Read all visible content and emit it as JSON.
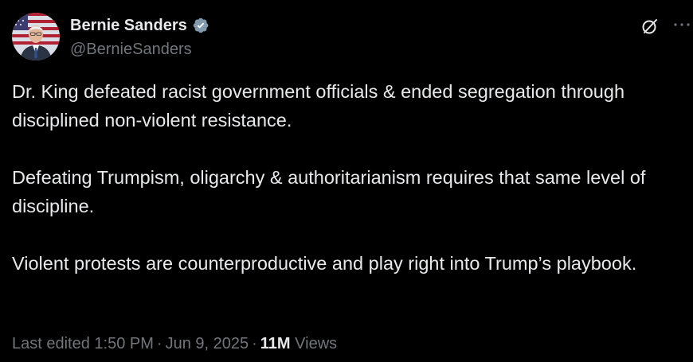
{
  "author": {
    "display_name": "Bernie Sanders",
    "handle": "@BernieSanders",
    "verified": true
  },
  "post": {
    "paragraphs": [
      "Dr. King defeated racist government officials & ended segregation through disciplined non-violent resistance.",
      "Defeating Trumpism, oligarchy & authoritarianism requires that same level of discipline.",
      "Violent protests are counterproductive and play right into Trump’s playbook."
    ]
  },
  "meta": {
    "edited_label": "Last edited",
    "time": "1:50 PM",
    "separator": "·",
    "date": "Jun 9, 2025",
    "views_count": "11M",
    "views_label": "Views"
  },
  "icons": {
    "verified": "verified-badge-icon",
    "grok": "grok-icon",
    "more": "more-icon"
  },
  "colors": {
    "background": "#000000",
    "text_primary": "#e7e9ea",
    "text_secondary": "#71767b",
    "verified": "#829aab"
  }
}
